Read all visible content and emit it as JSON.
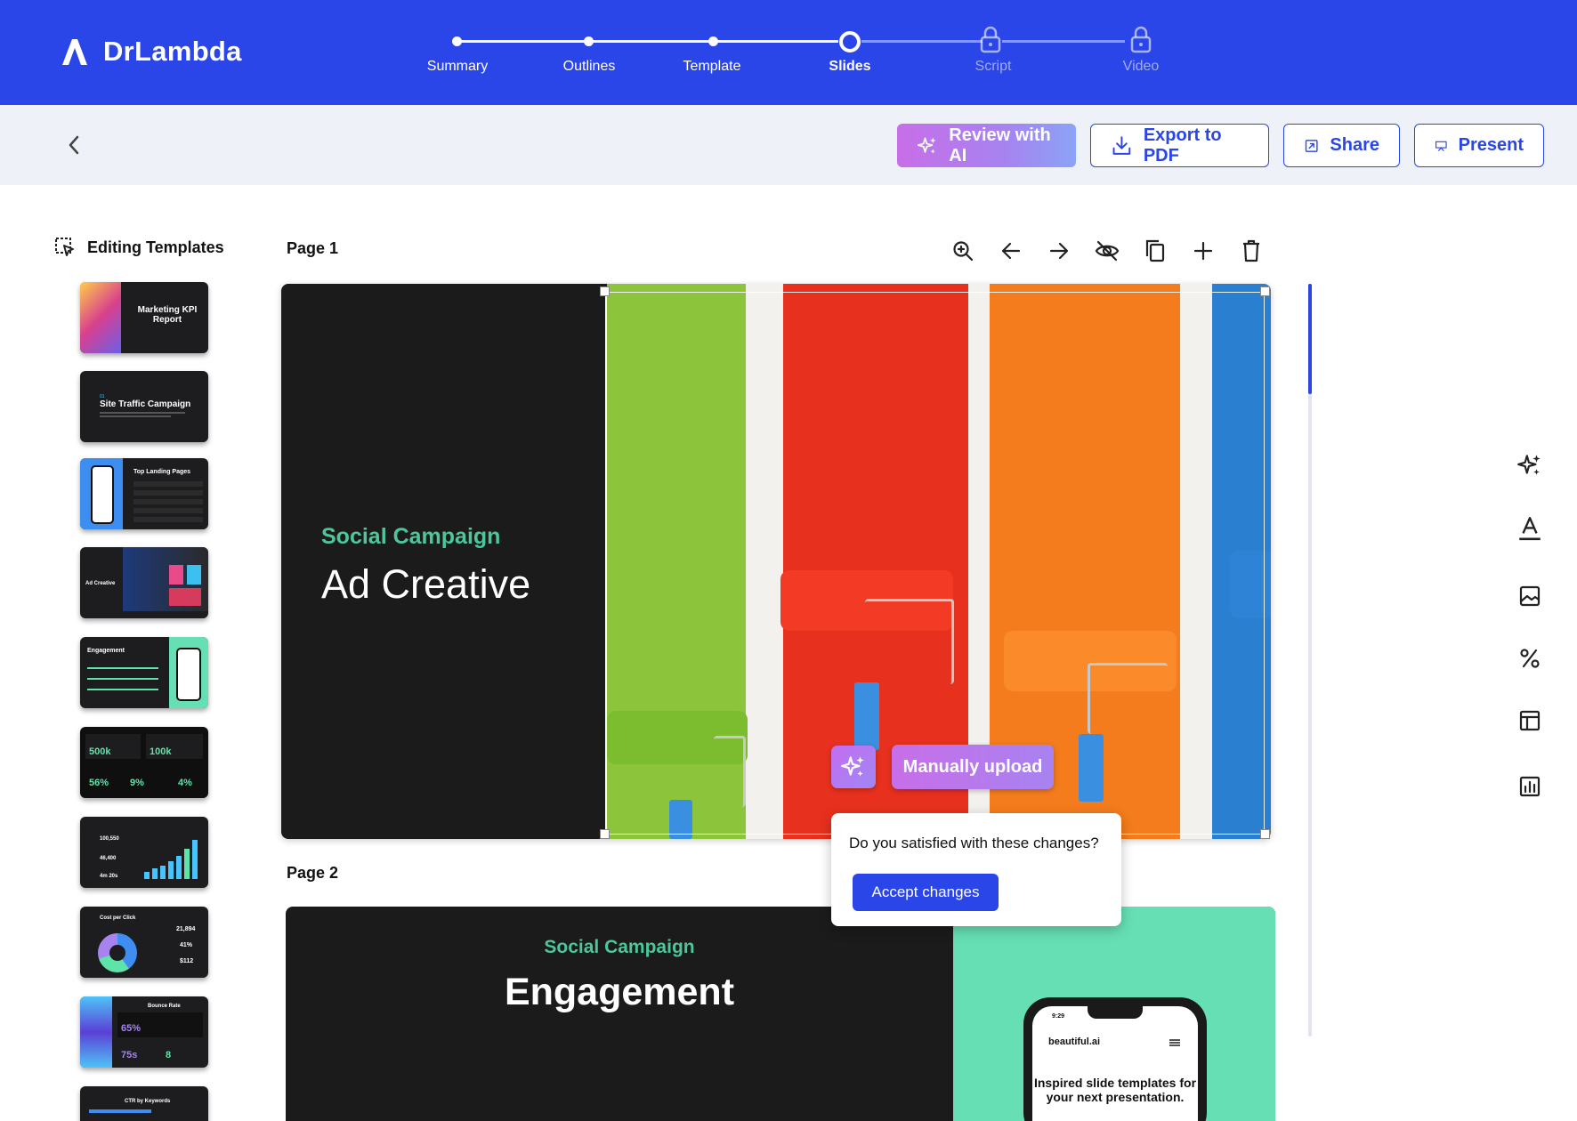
{
  "brand": {
    "name": "DrLambda"
  },
  "stepper": {
    "steps": [
      {
        "label": "Summary",
        "state": "done"
      },
      {
        "label": "Outlines",
        "state": "done"
      },
      {
        "label": "Template",
        "state": "done"
      },
      {
        "label": "Slides",
        "state": "current"
      },
      {
        "label": "Script",
        "state": "locked"
      },
      {
        "label": "Video",
        "state": "locked"
      }
    ]
  },
  "toolbar": {
    "review_ai": "Review with AI",
    "export_pdf": "Export to PDF",
    "share": "Share",
    "present": "Present"
  },
  "sidebar": {
    "title": "Editing Templates",
    "thumbs": [
      {
        "title": "Marketing KPI Report"
      },
      {
        "title": "Site Traffic Campaign",
        "kicker": "01"
      },
      {
        "title": "Top Landing Pages"
      },
      {
        "title": "Ad Creative"
      },
      {
        "title": "Engagement"
      },
      {
        "kpis": [
          "500k",
          "100k",
          "56%",
          "9%",
          "4%"
        ]
      },
      {
        "kpis": [
          "100,550",
          "46,400",
          "4m 20s"
        ]
      },
      {
        "title": "Cost per Click",
        "kpis": [
          "21,894",
          "41%",
          "$112"
        ]
      },
      {
        "title": "Bounce Rate",
        "kpis": [
          "65%",
          "75s",
          "8"
        ]
      },
      {
        "title": "CTR by Keywords"
      }
    ]
  },
  "pages": {
    "page1_label": "Page 1",
    "page2_label": "Page 2"
  },
  "slide1": {
    "subtitle": "Social Campaign",
    "title": "Ad Creative"
  },
  "slide2": {
    "subtitle": "Social Campaign",
    "title": "Engagement",
    "phone_time": "9:29",
    "phone_brand": "beautiful.ai",
    "phone_text": "Inspired slide templates for your next presentation."
  },
  "ai_popover": {
    "manual_upload": "Manually upload",
    "question": "Do you satisfied with these changes?",
    "accept": "Accept changes"
  },
  "colors": {
    "brand_blue": "#2a45e8",
    "accent_green": "#4cc79a",
    "ai_gradient_start": "#c86ee8",
    "ai_gradient_end": "#8ba3f6"
  }
}
